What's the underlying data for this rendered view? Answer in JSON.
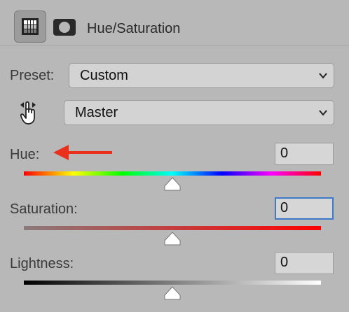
{
  "panel": {
    "title": "Hue/Saturation",
    "adjustment_icon": "adjustment-layer-icon",
    "mask_icon": "layer-mask-icon"
  },
  "preset": {
    "label": "Preset:",
    "value": "Custom"
  },
  "channel": {
    "value": "Master",
    "icon": "targeted-adjustment-hand-icon"
  },
  "sliders": [
    {
      "label": "Hue:",
      "value": "0"
    },
    {
      "label": "Saturation:",
      "value": "0"
    },
    {
      "label": "Lightness:",
      "value": "0"
    }
  ],
  "annotation": {
    "arrow_color": "#e8301c"
  },
  "colors": {
    "focus": "#3d79c7",
    "panel_bg": "#b8b8b8"
  }
}
